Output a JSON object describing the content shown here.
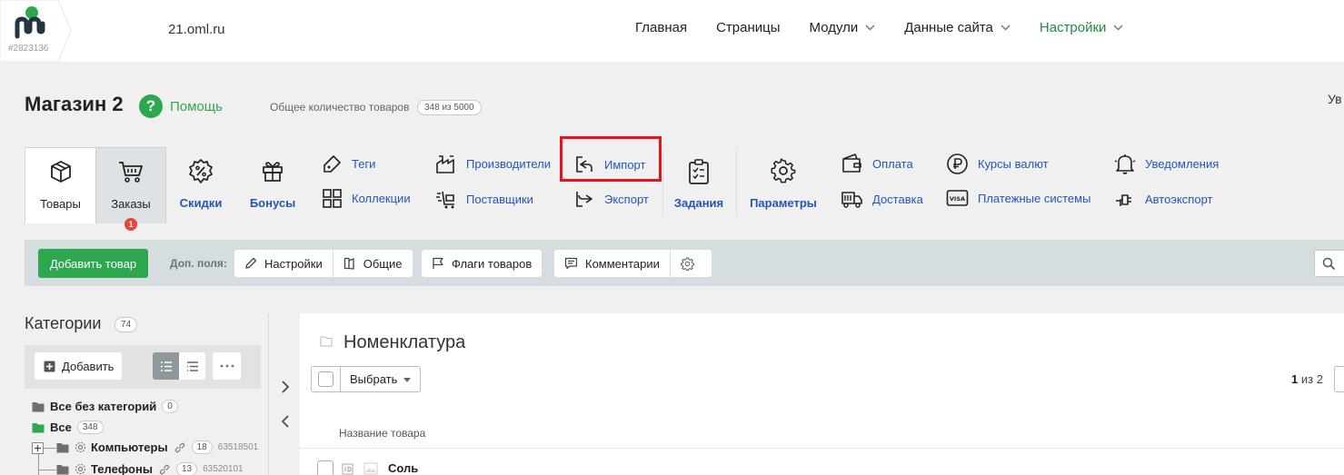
{
  "header": {
    "logo_id": "#2823136",
    "site": "21.oml.ru",
    "nav": [
      "Главная",
      "Страницы",
      "Модули",
      "Данные сайта",
      "Настройки"
    ],
    "active_nav": "Настройки"
  },
  "title_row": {
    "title": "Магазин 2",
    "help": "Помощь",
    "total_label": "Общее количество товаров",
    "total_value": "348 из 5000",
    "cut_text": "Ув"
  },
  "tabs": {
    "goods": "Товары",
    "orders": "Заказы",
    "orders_badge": "1",
    "discounts": "Скидки",
    "bonuses": "Бонусы",
    "tags": "Теги",
    "collections": "Коллекции",
    "manufacturers": "Производители",
    "suppliers": "Поставщики",
    "import": "Импорт",
    "export": "Экспорт",
    "tasks": "Задания",
    "params": "Параметры",
    "payment": "Оплата",
    "delivery": "Доставка",
    "currency": "Курсы валют",
    "payment_systems": "Платежные системы",
    "notifications": "Уведомления",
    "autoexport": "Автоэкспорт"
  },
  "toolbar": {
    "add_product": "Добавить товар",
    "extra_fields": "Доп. поля:",
    "settings": "Настройки",
    "common": "Общие",
    "flags": "Флаги товаров",
    "comments": "Комментарии"
  },
  "categories": {
    "title": "Категории",
    "count": "74",
    "add": "Добавить",
    "items": [
      {
        "name": "Все без категорий",
        "count": "0"
      },
      {
        "name": "Все",
        "count": "348"
      },
      {
        "name": "Компьютеры",
        "count": "18",
        "id": "63518501"
      },
      {
        "name": "Телефоны",
        "count": "13",
        "id": "63520101"
      }
    ]
  },
  "main": {
    "folder_title": "Номенклатура",
    "select": "Выбрать",
    "page_current": "1",
    "page_of": "из 2",
    "column_name": "Название товара",
    "rows": [
      {
        "name": "Соль"
      }
    ]
  },
  "colors": {
    "brand_green": "#2ea84f",
    "link_blue": "#2455b8",
    "highlight_red": "#e6131b",
    "badge_red": "#e6463c"
  }
}
